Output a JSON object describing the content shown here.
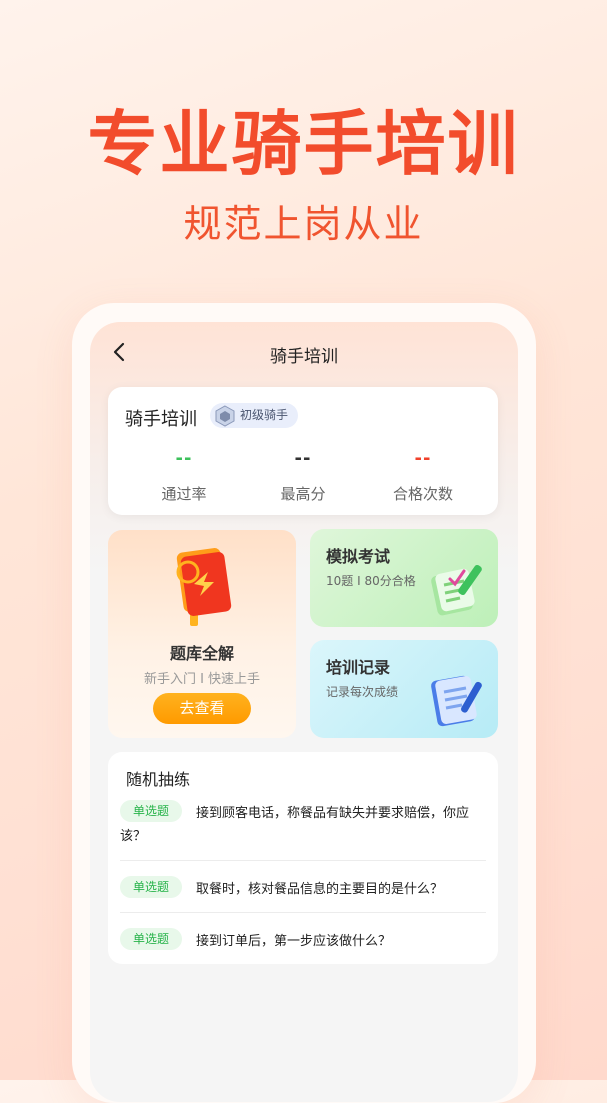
{
  "promo": {
    "headline": "专业骑手培训",
    "subhead": "规范上岗从业"
  },
  "navbar": {
    "title": "骑手培训",
    "back_icon": "chevron-left-icon"
  },
  "stats_card": {
    "title": "骑手培训",
    "badge": "初级骑手",
    "stats": [
      {
        "value": "--",
        "label": "通过率",
        "color": "#3cc15b"
      },
      {
        "value": "--",
        "label": "最高分",
        "color": "#333333"
      },
      {
        "value": "--",
        "label": "合格次数",
        "color": "#f0412b"
      }
    ]
  },
  "tiles": {
    "bank": {
      "title": "题库全解",
      "subtitle": "新手入门 I 快速上手",
      "button": "去查看"
    },
    "mock": {
      "title": "模拟考试",
      "subtitle": "10题 I 80分合格"
    },
    "record": {
      "title": "培训记录",
      "subtitle": "记录每次成绩"
    }
  },
  "practice": {
    "title": "随机抽练",
    "questions": [
      {
        "tag": "单选题",
        "text": "接到顾客电话，称餐品有缺失并要求赔偿，你应该？"
      },
      {
        "tag": "单选题",
        "text": "取餐时，核对餐品信息的主要目的是什么？"
      },
      {
        "tag": "单选题",
        "text": "接到订单后，第一步应该做什么？"
      }
    ]
  }
}
